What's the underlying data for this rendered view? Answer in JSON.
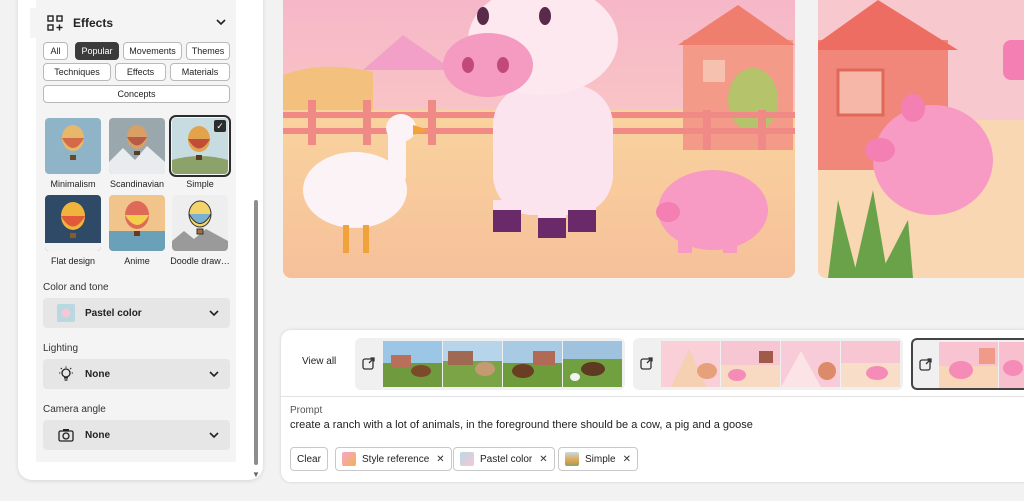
{
  "effects": {
    "title": "Effects",
    "filters": [
      {
        "label": "All",
        "active": false
      },
      {
        "label": "Popular",
        "active": true
      },
      {
        "label": "Movements",
        "active": false
      },
      {
        "label": "Themes",
        "active": false
      },
      {
        "label": "Techniques",
        "active": false
      },
      {
        "label": "Effects",
        "active": false
      },
      {
        "label": "Materials",
        "active": false
      },
      {
        "label": "Concepts",
        "active": false
      }
    ],
    "styles": [
      {
        "label": "Minimalism",
        "selected": false
      },
      {
        "label": "Scandinavian",
        "selected": false
      },
      {
        "label": "Simple",
        "selected": true
      },
      {
        "label": "Flat design",
        "selected": false
      },
      {
        "label": "Anime",
        "selected": false
      },
      {
        "label": "Doodle draw…",
        "selected": false
      }
    ]
  },
  "color_tone": {
    "label": "Color and tone",
    "value": "Pastel color"
  },
  "lighting": {
    "label": "Lighting",
    "value": "None",
    "icon": "bulb-icon"
  },
  "camera": {
    "label": "Camera angle",
    "value": "None",
    "icon": "camera-icon"
  },
  "history": {
    "view_all": "View all"
  },
  "prompt": {
    "label": "Prompt",
    "text": "create a ranch with a lot of animals, in the foreground there should be a cow, a pig and a goose"
  },
  "tags": {
    "clear": "Clear",
    "items": [
      {
        "label": "Style reference"
      },
      {
        "label": "Pastel color"
      },
      {
        "label": "Simple"
      }
    ]
  },
  "colors": {
    "accent": "#3b3b3b",
    "pink": "#f4a6c4",
    "sky": "#f6c7d8"
  }
}
